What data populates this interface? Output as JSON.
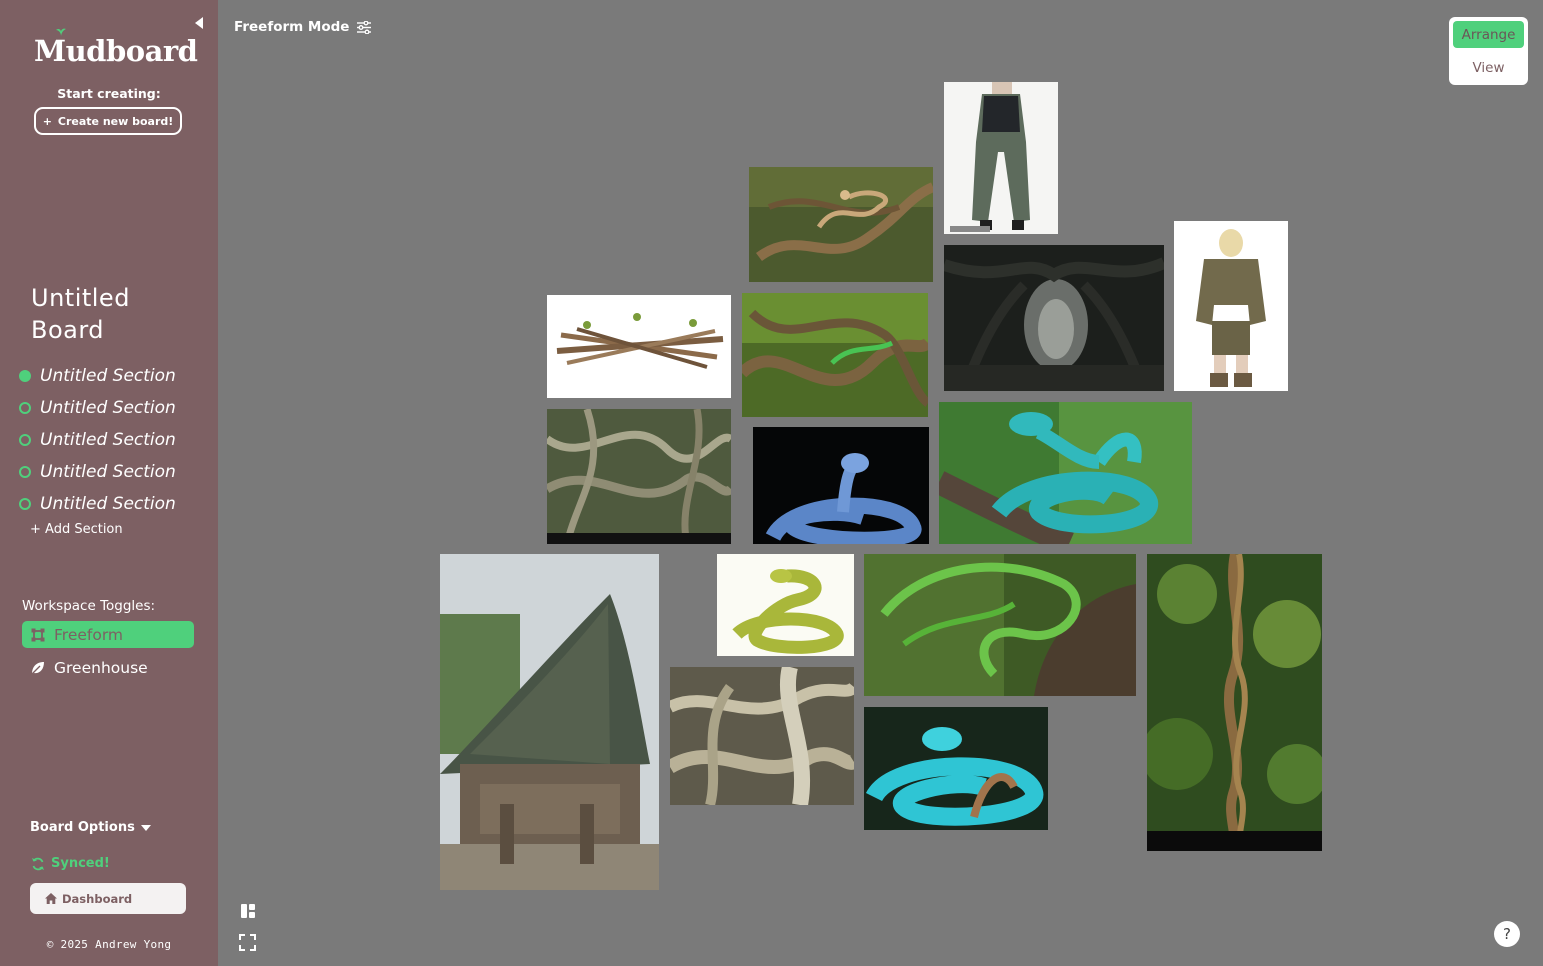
{
  "sidebar": {
    "logo": "Mudboard",
    "start_label": "Start creating:",
    "create_button": "Create new board!",
    "board_title": "Untitled Board",
    "sections": [
      {
        "label": "Untitled Section",
        "active": true
      },
      {
        "label": "Untitled Section",
        "active": false
      },
      {
        "label": "Untitled Section",
        "active": false
      },
      {
        "label": "Untitled Section",
        "active": false
      },
      {
        "label": "Untitled Section",
        "active": false
      }
    ],
    "add_section": "+ Add Section",
    "workspace_label": "Workspace Toggles:",
    "workspace_items": [
      {
        "label": "Freeform",
        "icon": "frame-icon",
        "active": true
      },
      {
        "label": "Greenhouse",
        "icon": "leaf-icon",
        "active": false
      }
    ],
    "board_options": "Board Options",
    "sync_status": "Synced!",
    "dashboard_button": "Dashboard",
    "copyright": "© 2025 Andrew Yong"
  },
  "header": {
    "mode_label": "Freeform Mode",
    "arrange_label": "Arrange",
    "view_label": "View"
  },
  "help_label": "?",
  "colors": {
    "sidebar_bg": "#7d6063",
    "canvas_bg": "#7a7a7a",
    "accent": "#4fd07c"
  },
  "board_images": [
    {
      "name": "image-fashion-coat",
      "subject": "fashion coat"
    },
    {
      "name": "image-vine-snake-branch",
      "subject": "vine snake on branch"
    },
    {
      "name": "image-dark-forest-tunnel",
      "subject": "dark forest tunnel"
    },
    {
      "name": "image-fashion-jacket",
      "subject": "fashion jacket"
    },
    {
      "name": "image-twig-bundle",
      "subject": "twig bundle"
    },
    {
      "name": "image-green-vines-snake",
      "subject": "green vines with snake"
    },
    {
      "name": "image-tangled-vines",
      "subject": "tangled vines"
    },
    {
      "name": "image-blue-viper-dark",
      "subject": "blue viper on black"
    },
    {
      "name": "image-teal-viper-branch",
      "subject": "teal viper on branch"
    },
    {
      "name": "image-thatched-house",
      "subject": "thatched roof house"
    },
    {
      "name": "image-yellow-snake",
      "subject": "yellow-green snake"
    },
    {
      "name": "image-green-vine-snake",
      "subject": "green vine snake"
    },
    {
      "name": "image-twisted-vine",
      "subject": "twisted jungle vine"
    },
    {
      "name": "image-root-tangle",
      "subject": "root tangle"
    },
    {
      "name": "image-blue-viper-coiled",
      "subject": "coiled blue viper"
    }
  ]
}
